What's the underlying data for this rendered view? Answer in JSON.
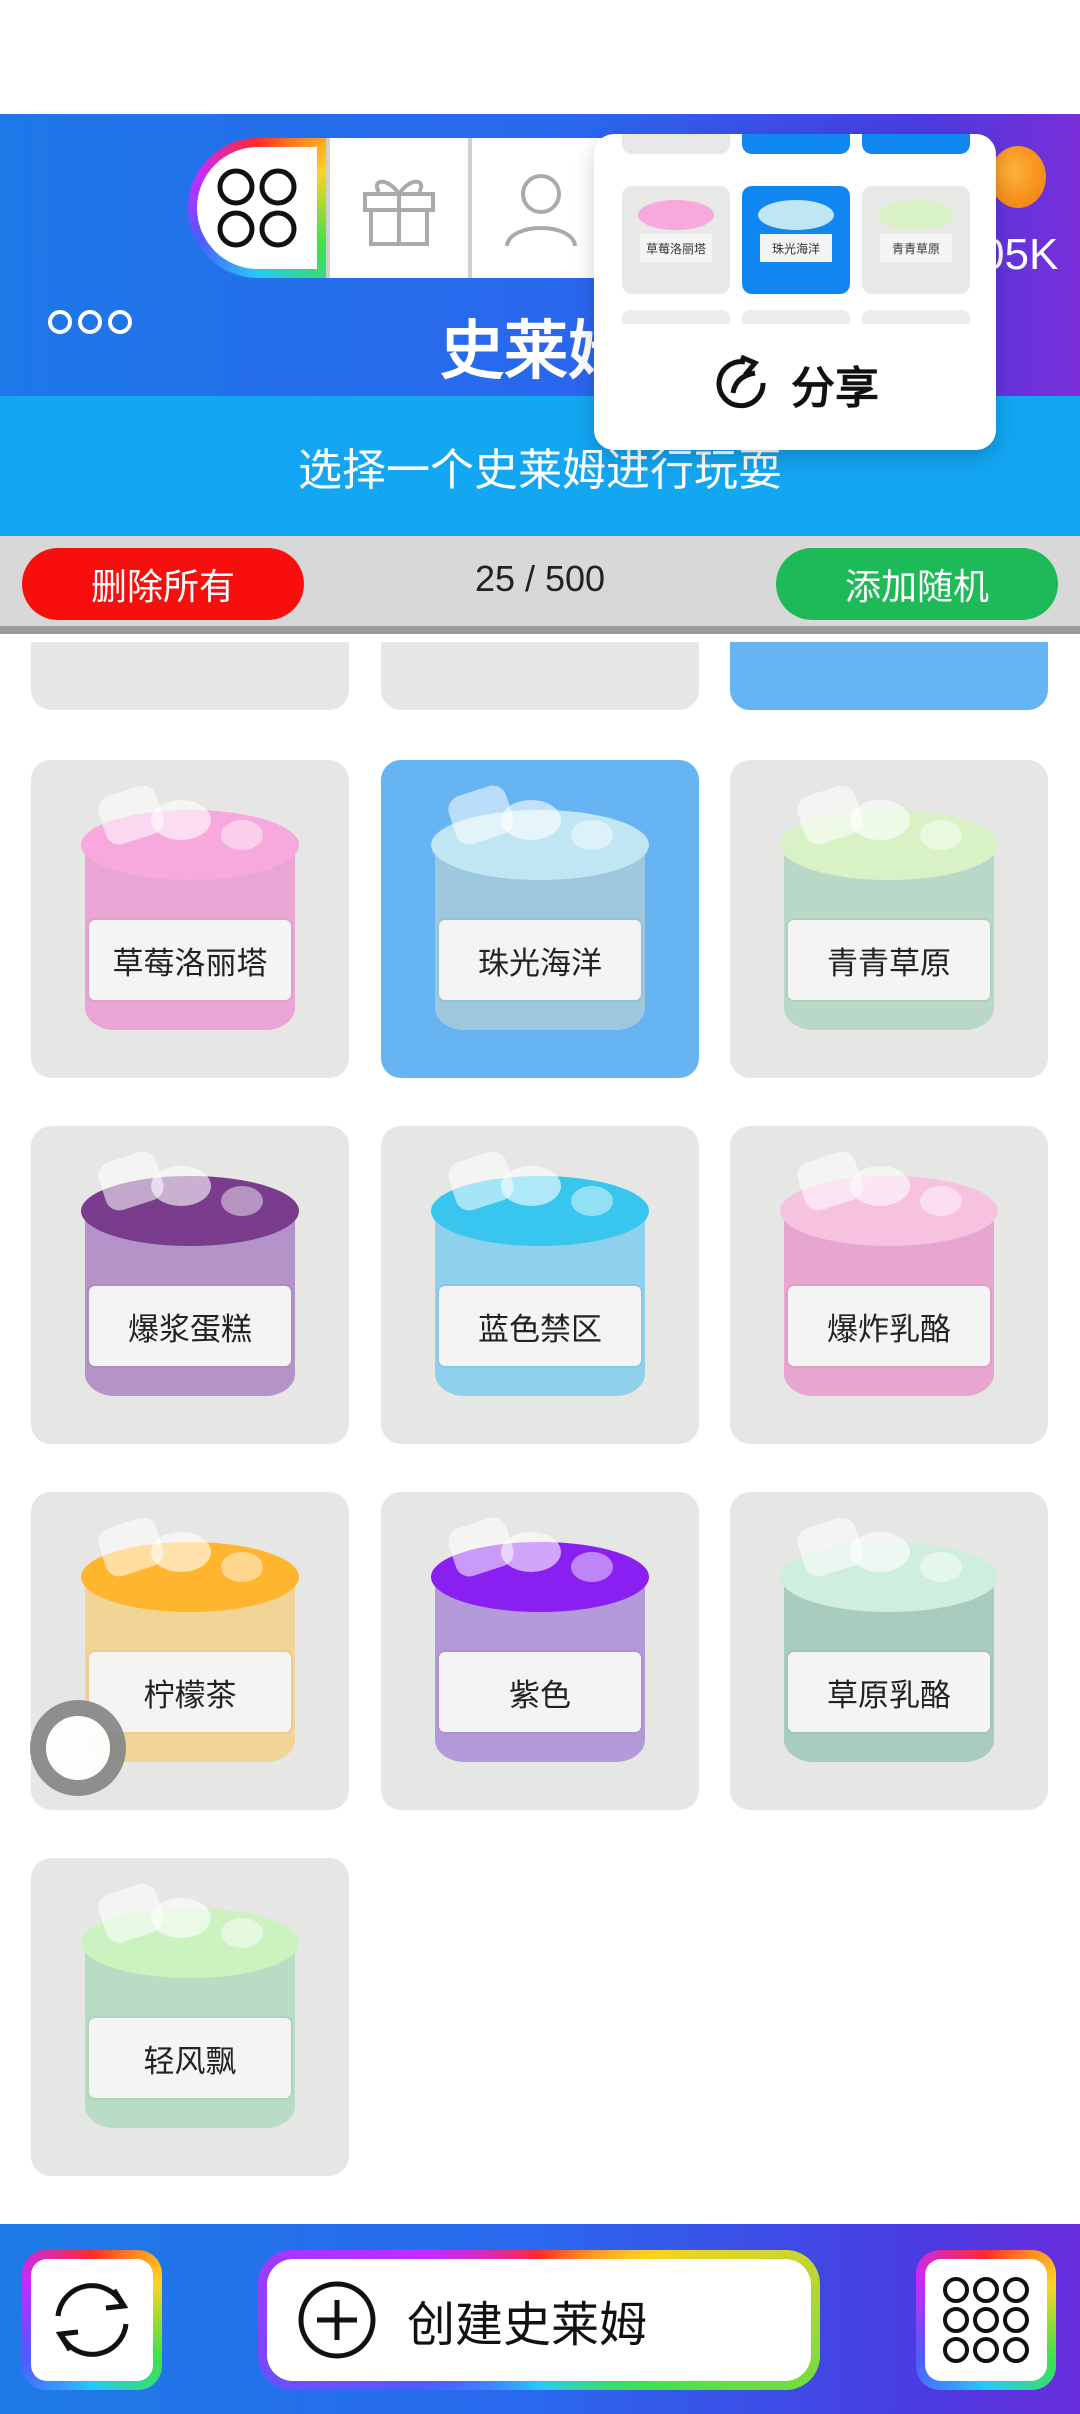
{
  "header": {
    "title": "史莱姆",
    "subtitle": "选择一个史莱姆进行玩耍",
    "coins": "05K",
    "tabs": [
      "slime-collection",
      "gifts",
      "profile"
    ],
    "colors": {
      "header_start": "#1e78e8",
      "header_end": "#7a2ed8",
      "subtitle_bg": "#13a6f2"
    }
  },
  "controls": {
    "delete_all_label": "删除所有",
    "counter_label": "25 / 500",
    "count_current": 25,
    "count_max": 500,
    "add_random_label": "添加随机",
    "colors": {
      "delete": "#f90e0e",
      "add": "#1fba58"
    }
  },
  "slimes": [
    {
      "name": "草莓洛丽塔",
      "selected": false,
      "color": "#e9a6d4",
      "top": "#f7a8dc"
    },
    {
      "name": "珠光海洋",
      "selected": true,
      "color": "#9ec8de",
      "top": "#bfe6f2"
    },
    {
      "name": "青青草原",
      "selected": false,
      "color": "#b9d8c8",
      "top": "#d8f2c6"
    },
    {
      "name": "爆浆蛋糕",
      "selected": false,
      "color": "#b494c8",
      "top": "#7a3d8e"
    },
    {
      "name": "蓝色禁区",
      "selected": false,
      "color": "#8fd1ec",
      "top": "#39c6ee"
    },
    {
      "name": "爆炸乳酪",
      "selected": false,
      "color": "#e6a6cf",
      "top": "#f6c2e0"
    },
    {
      "name": "柠檬茶",
      "selected": false,
      "color": "#f2d496",
      "top": "#ffb52e"
    },
    {
      "name": "紫色",
      "selected": false,
      "color": "#b59ad9",
      "top": "#8a1ff2"
    },
    {
      "name": "草原乳酪",
      "selected": false,
      "color": "#a8ccbe",
      "top": "#cfeedd"
    },
    {
      "name": "轻风飘",
      "selected": false,
      "color": "#b8dcc4",
      "top": "#ccf2c0"
    }
  ],
  "popup": {
    "items": [
      {
        "name": "草莓洛丽塔",
        "selected": false,
        "top": "#f7a8dc"
      },
      {
        "name": "珠光海洋",
        "selected": true,
        "top": "#bfe6f2"
      },
      {
        "name": "青青草原",
        "selected": false,
        "top": "#d8f2c6"
      }
    ],
    "share_label": "分享"
  },
  "bottom": {
    "create_label": "创建史莱姆"
  }
}
